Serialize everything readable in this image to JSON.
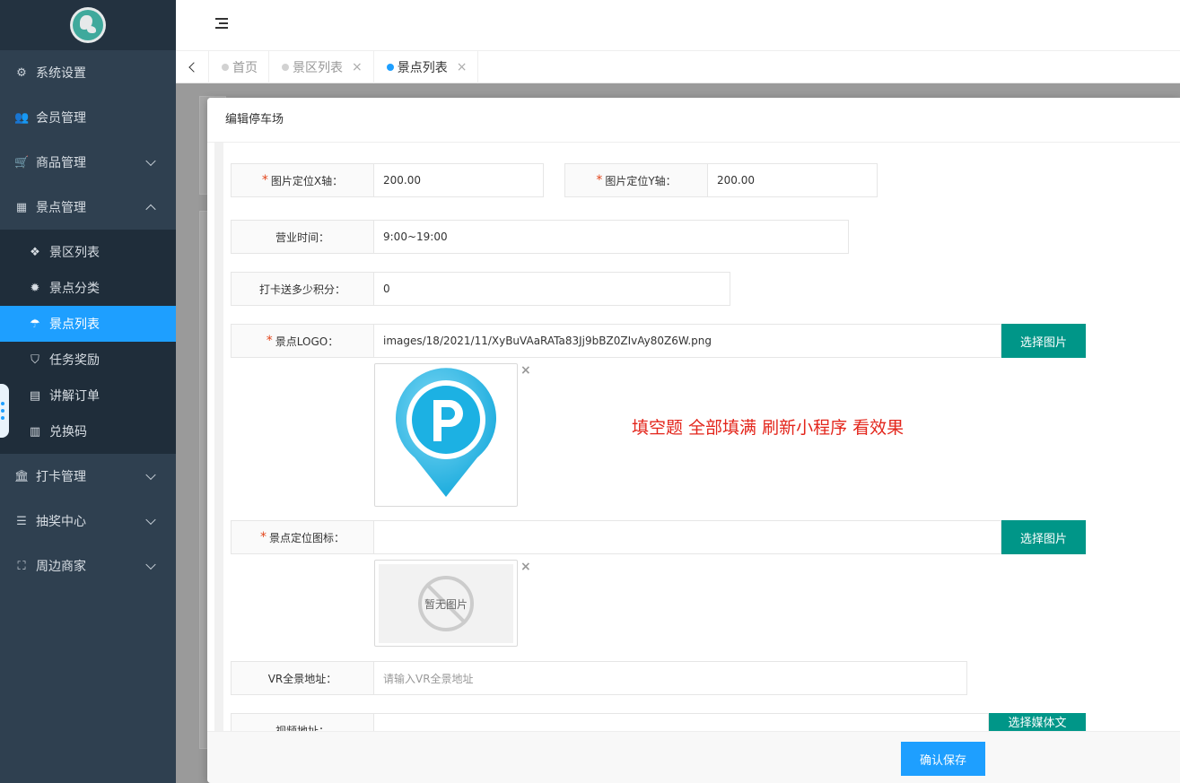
{
  "sidebar": {
    "menu": [
      {
        "label": "系统设置",
        "icon": "gears-icon"
      },
      {
        "label": "会员管理",
        "icon": "users-icon"
      },
      {
        "label": "商品管理",
        "icon": "cart-icon"
      },
      {
        "label": "景点管理",
        "icon": "grid-icon"
      },
      {
        "label": "打卡管理",
        "icon": "bank-icon"
      },
      {
        "label": "抽奖中心",
        "icon": "database-icon"
      },
      {
        "label": "周边商家",
        "icon": "sitemap-icon"
      }
    ],
    "submenu": [
      {
        "label": "景区列表",
        "icon": "cubes-icon"
      },
      {
        "label": "景点分类",
        "icon": "certificate-icon"
      },
      {
        "label": "景点列表",
        "icon": "umbrella-icon"
      },
      {
        "label": "任务奖励",
        "icon": "shield-icon"
      },
      {
        "label": "讲解订单",
        "icon": "audio-file-icon"
      },
      {
        "label": "兑换码",
        "icon": "barcode-icon"
      }
    ]
  },
  "tabs": [
    {
      "label": "首页",
      "close": ""
    },
    {
      "label": "景区列表",
      "close": "×"
    },
    {
      "label": "景点列表",
      "close": "×"
    }
  ],
  "modal": {
    "title": "编辑停车场",
    "fields": {
      "pos_x_label": "图片定位X轴：",
      "pos_x_value": "200.00",
      "pos_y_label": "图片定位Y轴：",
      "pos_y_value": "200.00",
      "hours_label": "营业时间：",
      "hours_value": "9:00~19:00",
      "points_label": "打卡送多少积分：",
      "points_value": "0",
      "logo_label": "景点LOGO：",
      "logo_value": "images/18/2021/11/XyBuVAaRATa83Jj9bBZ0ZIvAy80Z6W.png",
      "marker_label": "景点定位图标：",
      "marker_value": "",
      "vr_label": "VR全景地址：",
      "vr_placeholder": "请输入VR全景地址",
      "video_label": "视频地址："
    },
    "choose_image": "选择图片",
    "choose_media": "选择媒体文件",
    "no_image": "暂无图片",
    "remove": "×",
    "required_mark": "*",
    "tip": "填空题 全部填满 刷新小程序 看效果",
    "save": "确认保存"
  },
  "colors": {
    "sidebar_bg": "#2f4050",
    "active_blue": "#1e9fff",
    "green_button": "#009688",
    "required_red": "#e3451b",
    "tip_red": "#e3251b"
  }
}
